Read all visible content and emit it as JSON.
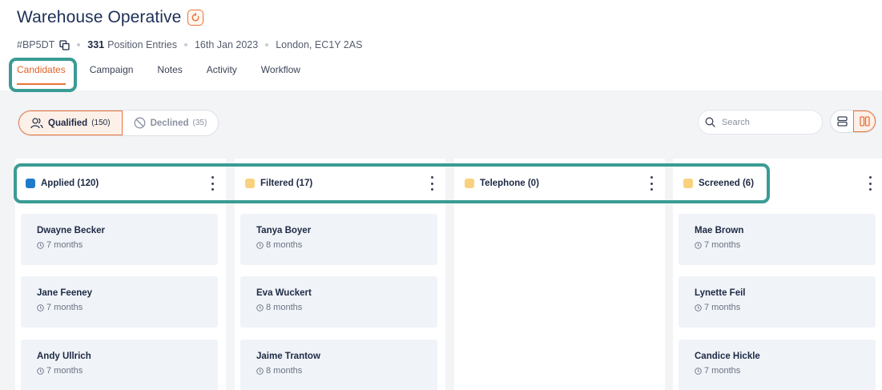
{
  "page": {
    "title": "Warehouse Operative",
    "job_id": "#BP5DT",
    "position_count": "331",
    "position_label": "Position Entries",
    "date": "16th Jan 2023",
    "location": "London, EC1Y 2AS"
  },
  "tabs": [
    {
      "label": "Candidates",
      "active": true
    },
    {
      "label": "Campaign"
    },
    {
      "label": "Notes"
    },
    {
      "label": "Activity"
    },
    {
      "label": "Workflow"
    }
  ],
  "filters": {
    "qualified": {
      "label": "Qualified",
      "count": "(150)"
    },
    "declined": {
      "label": "Declined",
      "count": "(35)"
    }
  },
  "search": {
    "placeholder": "Search"
  },
  "colors": {
    "accent": "#e8733a",
    "highlight": "#3a9c94",
    "applied": "#1f7bc9",
    "stage": "#f8d27e"
  },
  "columns": [
    {
      "label": "Applied (120)",
      "color": "#1f7bc9",
      "cards": [
        {
          "name": "Dwayne Becker",
          "ago": "7 months"
        },
        {
          "name": "Jane Feeney",
          "ago": "7 months"
        },
        {
          "name": "Andy Ullrich",
          "ago": "7 months"
        }
      ]
    },
    {
      "label": "Filtered (17)",
      "color": "#f8d27e",
      "cards": [
        {
          "name": "Tanya Boyer",
          "ago": "8 months"
        },
        {
          "name": "Eva Wuckert",
          "ago": "8 months"
        },
        {
          "name": "Jaime Trantow",
          "ago": "8 months"
        }
      ]
    },
    {
      "label": "Telephone (0)",
      "color": "#f8d27e",
      "cards": []
    },
    {
      "label": "Screened (6)",
      "color": "#f8d27e",
      "cards": [
        {
          "name": "Mae Brown",
          "ago": "7 months"
        },
        {
          "name": "Lynette Feil",
          "ago": "7 months"
        },
        {
          "name": "Candice Hickle",
          "ago": "7 months"
        }
      ]
    }
  ]
}
